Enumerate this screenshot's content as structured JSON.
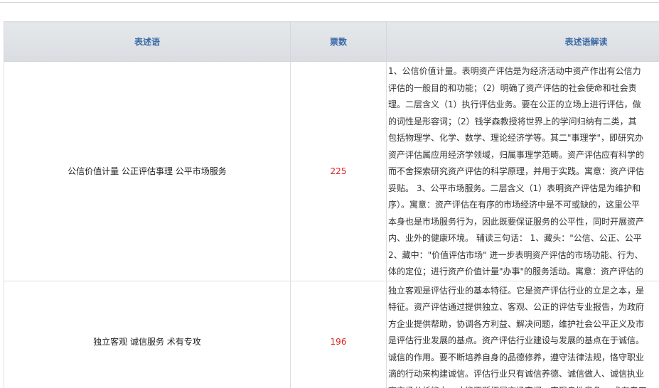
{
  "table": {
    "headers": [
      "表述语",
      "票数",
      "表述语解读"
    ],
    "rows": [
      {
        "phrase": "公信价值计量 公正评估事理 公平市场服务",
        "votes": "225",
        "desc": "1、公信价值计量。表明资产评估是为经济活动中资产作出有公信力\n评估的一般目的和功能；（2）明确了资产评估的社会使命和社会责\n理。二层含义（1）执行评估业务。要在公正的立场上进行评估，做\n的词性是形容词；（2）钱学森教授将世界上的学问归纳有二类，其\n包括物理学、化学、数学、理论经济学等。其二\"事理学\"，即研究办\n资产评估属应用经济学领域，归属事理学范畴。资产评估应有科学的\n而不舍探索研究资产评估的科学原理，并用于实践。寓意：资产评估\n妥贴。 3、公平市场服务。二层含义（1）表明资产评估是为维护和\n序）。寓意：资产评估在有序的市场经济中是不可或缺的，这里公平\n本身也是市场服务行为，因此既要保证服务的公平性，同时开展资产\n内、业外的健康环境。 辅读三句话： 1、藏头：\"公信、公正、公平\n2、藏中：\"价值评估市场\" 进一步表明资产评估的市场功能、行为、\n体的定位；进行资产价值计量\"办事\"的服务活动。寓意：资产评估的"
      },
      {
        "phrase": "独立客观 诚信服务 术有专攻",
        "votes": "196",
        "desc": "独立客观是评估行业的基本特征。它是资产评估行业的立足之本，是\n特征。资产评估通过提供独立、客观、公正的评估专业报告，为政府\n方企业提供帮助，协调各方利益、解决问题，维护社会公平正义及市\n是评估行业发展的基点。资产评估行业建设与发展的基点在于诚信。\n诚信的作用。要不断培养自身的品德修养，遵守法律法规，恪守职业\n滴的行动来构建诚信。评估行业只有诚信养德、诚信做人、诚信执业\n高市场分析能力，才能不断拓展市场空间、实现良性竞争。 术有专工"
      }
    ]
  }
}
